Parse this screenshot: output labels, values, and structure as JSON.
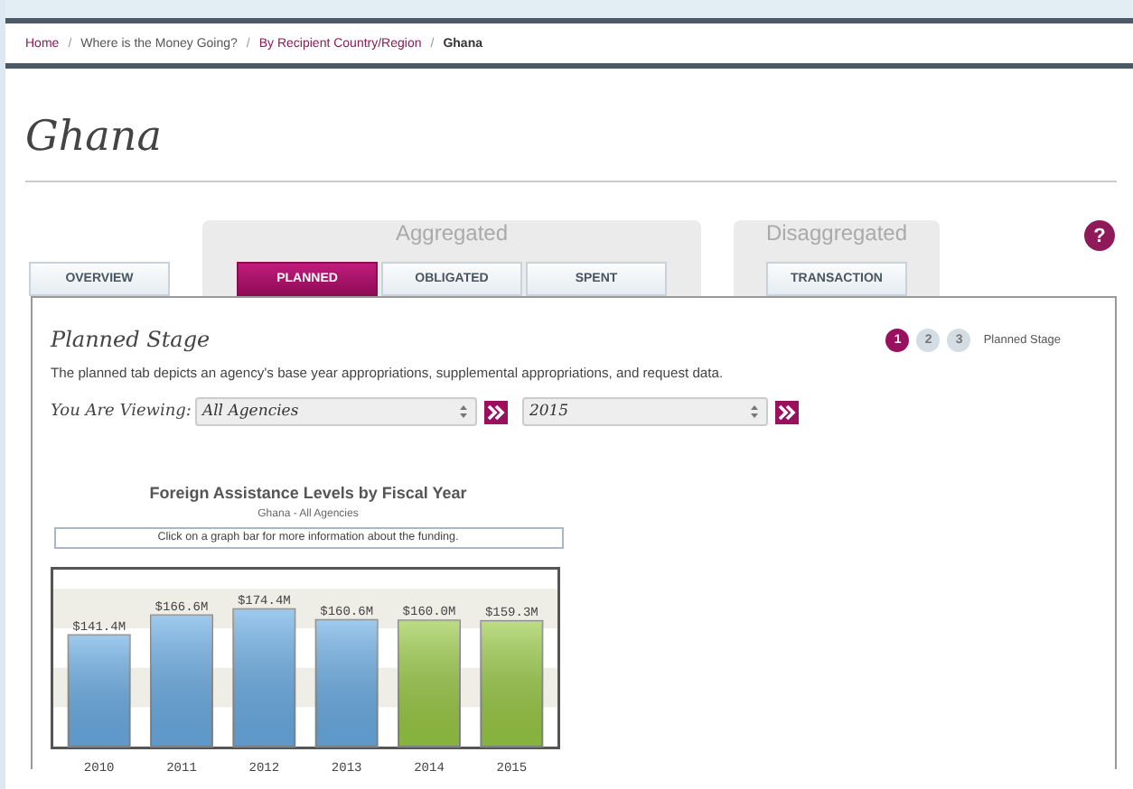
{
  "breadcrumb": [
    {
      "label": "Home",
      "kind": "link"
    },
    {
      "label": "Where is the Money Going?",
      "kind": "plain"
    },
    {
      "label": "By Recipient Country/Region",
      "kind": "link"
    },
    {
      "label": "Ghana",
      "kind": "current"
    }
  ],
  "breadcrumb_separators": [
    "/",
    "/",
    "/"
  ],
  "page_title": "Ghana",
  "tabs": [
    {
      "label": "OVERVIEW",
      "selected": false
    }
  ],
  "tab_groups": [
    {
      "title": "Aggregated",
      "tabs": [
        {
          "label": "PLANNED",
          "selected": true
        },
        {
          "label": "OBLIGATED",
          "selected": false
        },
        {
          "label": "SPENT",
          "selected": false
        }
      ]
    },
    {
      "title": "Disaggregated",
      "tabs": [
        {
          "label": "TRANSACTION",
          "selected": false
        }
      ]
    }
  ],
  "help": "?",
  "stage": {
    "title": "Planned Stage",
    "description": "The planned tab depicts an agency's base year appropriations, supplemental appropriations, and request data.",
    "steps": [
      {
        "label": "1",
        "selected": true
      },
      {
        "label": "2",
        "selected": false
      },
      {
        "label": "3",
        "selected": false
      }
    ],
    "step_caption": "Planned Stage"
  },
  "viewing": {
    "label": "You Are Viewing:",
    "agency": "All Agencies",
    "year": "2015"
  },
  "chart": {
    "title": "Foreign Assistance Levels by Fiscal Year",
    "subtitle": "Ghana - All Agencies",
    "hint": "Click on a graph bar for more information about the funding.",
    "chart_data": {
      "type": "bar",
      "categories": [
        "2010",
        "2011",
        "2012",
        "2013",
        "2014",
        "2015"
      ],
      "series": [
        {
          "color": "#6aaee6",
          "values": [
            141.4,
            166.6,
            174.4,
            160.6,
            null,
            null
          ],
          "value_labels": [
            "$141.4M",
            "$166.6M",
            "$174.4M",
            "$160.6M",
            null,
            null
          ]
        },
        {
          "color": "#9acb45",
          "values": [
            null,
            null,
            null,
            null,
            160.0,
            159.3
          ],
          "value_labels": [
            null,
            null,
            null,
            null,
            "$160.0M",
            "$159.3M"
          ]
        }
      ]
    }
  }
}
